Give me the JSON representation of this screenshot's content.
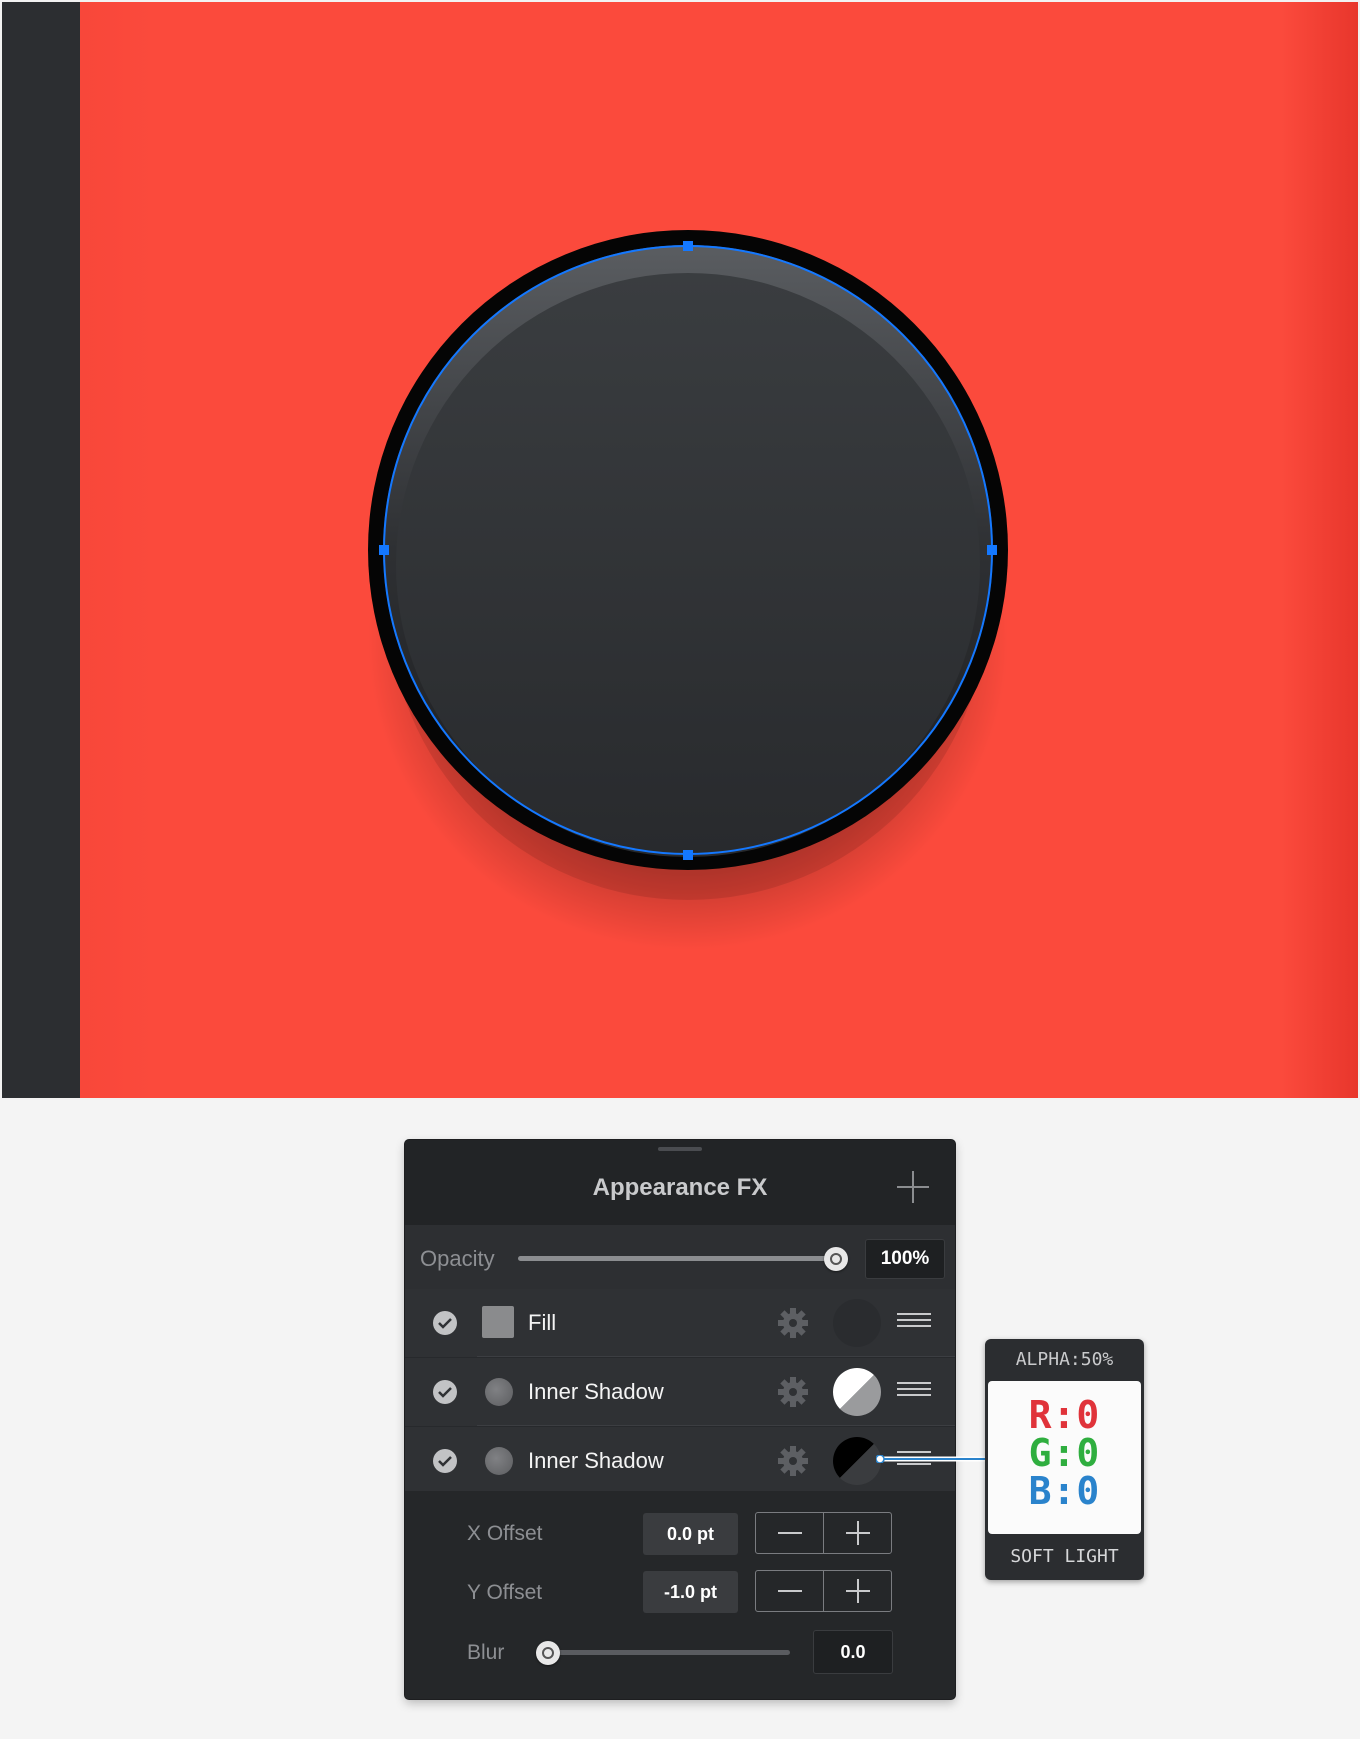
{
  "canvas": {
    "background_color": "#fb4a3c",
    "side_strip_color": "#2c2e31",
    "knob_color": "#2f3235",
    "selection_color": "#1478ff"
  },
  "panel": {
    "title": "Appearance FX",
    "add_icon": "plus-icon",
    "opacity": {
      "label": "Opacity",
      "value_text": "100%",
      "level_percent": 100
    },
    "layers": [
      {
        "label": "Fill",
        "enabled": true,
        "swatch": "square",
        "preview": "dark-fill"
      },
      {
        "label": "Inner Shadow",
        "enabled": true,
        "swatch": "circle",
        "preview": "white-half"
      },
      {
        "label": "Inner Shadow",
        "enabled": true,
        "swatch": "circle",
        "preview": "black-half"
      }
    ],
    "params": {
      "x_offset": {
        "label": "X Offset",
        "value": "0.0 pt"
      },
      "y_offset": {
        "label": "Y Offset",
        "value": "-1.0 pt"
      },
      "blur": {
        "label": "Blur",
        "value": "0.0",
        "level_percent": 0
      }
    }
  },
  "callout": {
    "alpha": "ALPHA:50%",
    "r": "R:0",
    "g": "G:0",
    "b": "B:0",
    "blend": "SOFT LIGHT"
  }
}
